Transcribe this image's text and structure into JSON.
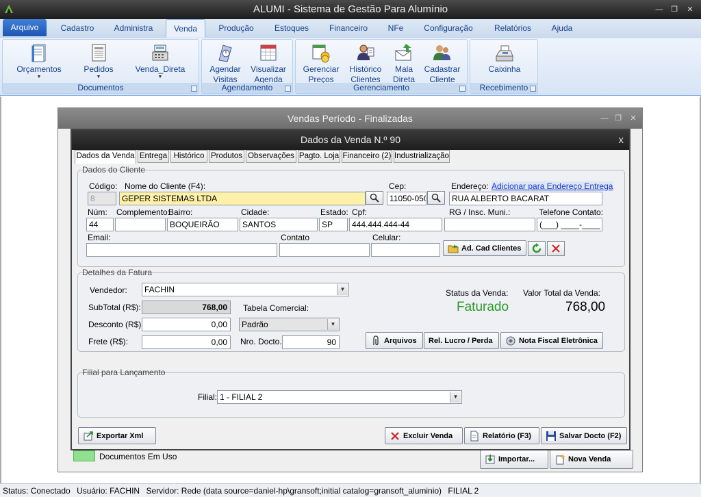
{
  "app": {
    "title": "ALUMI - Sistema de Gestão Para Alumínio"
  },
  "window_controls": {
    "minimize": "—",
    "restore": "❐",
    "close": "✕"
  },
  "ribbon": {
    "tabs": [
      "Arquivo",
      "Cadastro",
      "Administra",
      "Venda",
      "Produção",
      "Estoques",
      "Financeiro",
      "NFe",
      "Configuração",
      "Relatórios",
      "Ajuda"
    ],
    "active_tab": "Venda",
    "groups": {
      "documentos": {
        "caption": "Documentos",
        "buttons": [
          "Orçamentos",
          "Pedidos",
          "Venda_Direta"
        ]
      },
      "agendamento": {
        "caption": "Agendamento",
        "buttons": [
          [
            "Agendar",
            "Visitas"
          ],
          [
            "Visualizar",
            "Agenda"
          ]
        ]
      },
      "gerenciamento": {
        "caption": "Gerenciamento",
        "buttons": [
          [
            "Gerenciar",
            "Preços"
          ],
          [
            "Histórico",
            "Clientes"
          ],
          [
            "Mala",
            "Direta"
          ],
          [
            "Cadastrar",
            "Cliente"
          ]
        ]
      },
      "recebimento": {
        "caption": "Recebimento",
        "buttons": [
          "Caixinha"
        ]
      }
    }
  },
  "background_window": {
    "title": "Vendas Período - Finalizadas",
    "legend_label": "Documentos Em Uso",
    "import_button": "Importar...",
    "new_sale_button": "Nova Venda"
  },
  "dialog": {
    "title": "Dados da Venda N.º 90",
    "close": "x",
    "tabs": [
      "Dados da Venda",
      "Entrega",
      "Histórico",
      "Produtos",
      "Observações",
      "Pagto. Loja",
      "Financeiro (2)",
      "Industrialização"
    ],
    "active_tab": "Dados da Venda",
    "cliente": {
      "section_title": "Dados do Cliente",
      "codigo_label": "Código:",
      "codigo": "8",
      "nome_label": "Nome do Cliente (F4):",
      "nome": "GEPER SISTEMAS LTDA",
      "cep_label": "Cep:",
      "cep": "11050-050",
      "endereco_label": "Endereço:",
      "endereco_link": "Adicionar para Endereço Entrega",
      "endereco": "RUA ALBERTO BACARAT",
      "num_label": "Núm:",
      "num": "44",
      "complemento_label": "Complemento:",
      "complemento": "",
      "bairro_label": "Bairro:",
      "bairro": "BOQUEIRÃO",
      "cidade_label": "Cidade:",
      "cidade": "SANTOS",
      "estado_label": "Estado:",
      "estado": "SP",
      "cpf_label": "Cpf:",
      "cpf": "444.444.444-44",
      "rg_label": "RG / Insc. Muni.:",
      "rg": "",
      "telefone_label": "Telefone Contato:",
      "telefone": "(___) ____-____",
      "email_label": "Email:",
      "email": "",
      "contato_label": "Contato",
      "contato": "",
      "celular_label": "Celular:",
      "celular": "",
      "ad_cad_button": "Ad. Cad Clientes"
    },
    "fatura": {
      "section_title": "Detalhes da Fatura",
      "vendedor_label": "Vendedor:",
      "vendedor": "FACHIN",
      "subtotal_label": "SubTotal (R$):",
      "subtotal": "768,00",
      "tabela_label": "Tabela Comercial:",
      "tabela": "Padrão",
      "desconto_label": "Desconto (R$):",
      "desconto": "0,00",
      "frete_label": "Frete (R$):",
      "frete": "0,00",
      "nro_docto_label": "Nro. Docto.:",
      "nro_docto": "90",
      "status_label": "Status da Venda:",
      "status": "Faturado",
      "valor_total_label": "Valor Total da Venda:",
      "valor_total": "768,00",
      "arquivos_button": "Arquivos",
      "rel_lucro_button": "Rel. Lucro / Perda",
      "nfe_button": "Nota Fiscal Eletrônica"
    },
    "filial": {
      "section_title": "Filial para Lançamento",
      "label": "Filial:",
      "value": "1 - FILIAL 2"
    },
    "footer": {
      "exportar_button": "Exportar Xml",
      "excluir_button": "Excluir Venda",
      "relatorio_button": "Relatório (F3)",
      "salvar_button": "Salvar Docto (F2)"
    }
  },
  "statusbar": {
    "status": "Status: Conectado",
    "usuario": "Usuário: FACHIN",
    "servidor": "Servidor: Rede (data source=daniel-hp\\gransoft;initial catalog=gransoft_aluminio)",
    "filial": "FILIAL 2"
  },
  "colors": {
    "status_faturado": "#2a9a2a",
    "legend_em_uso": "#8fe08f"
  }
}
